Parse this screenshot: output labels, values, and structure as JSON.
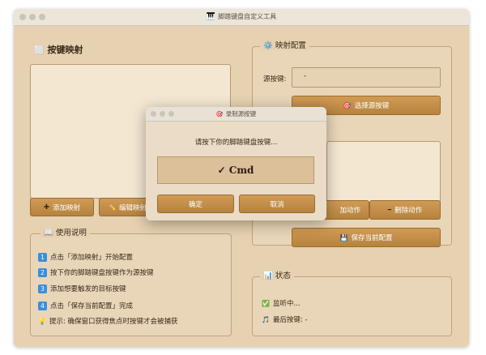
{
  "window": {
    "title": "脚踏键盘自定义工具",
    "title_icon": "🎹"
  },
  "mapping_list": {
    "heading": "按键映射",
    "heading_icon": "⬜"
  },
  "buttons": {
    "add_mapping": "添加映射",
    "add_icon": "✚",
    "edit_mapping": "编辑映射",
    "edit_icon": "✏️"
  },
  "config": {
    "legend": "映射配置",
    "legend_icon": "⚙️",
    "source_label": "源按键:",
    "source_value": "-",
    "choose_source": "选择源按键",
    "choose_icon": "🎯",
    "add_action": "加动作",
    "delete_action": "删除动作",
    "delete_icon": "━",
    "save_config": "保存当前配置",
    "save_icon": "💾"
  },
  "instructions": {
    "legend": "使用说明",
    "legend_icon": "📖",
    "steps": [
      {
        "num": "1",
        "text": "点击「添加映射」开始配置"
      },
      {
        "num": "2",
        "text": "按下你的脚踏键盘按键作为源按键"
      },
      {
        "num": "3",
        "text": "添加想要触发的目标按键"
      },
      {
        "num": "4",
        "text": "点击「保存当前配置」完成"
      }
    ],
    "tip_icon": "💡",
    "tip": "提示: 确保窗口获得焦点时按键才会被捕获"
  },
  "status": {
    "legend": "状态",
    "legend_icon": "📊",
    "listening_icon": "✅",
    "listening": "监听中...",
    "last_key_icon": "🎵",
    "last_key": "最后按键: -"
  },
  "dialog": {
    "title": "录制源按键",
    "title_icon": "🎯",
    "prompt": "请按下你的脚踏键盘按键...",
    "captured": "✓ Cmd",
    "ok": "确定",
    "cancel": "取消"
  },
  "colors": {
    "accent": "#c08a45",
    "background": "#e6d1b1",
    "panel": "#f4e7d2",
    "step_badge": "#3b8fd9"
  }
}
